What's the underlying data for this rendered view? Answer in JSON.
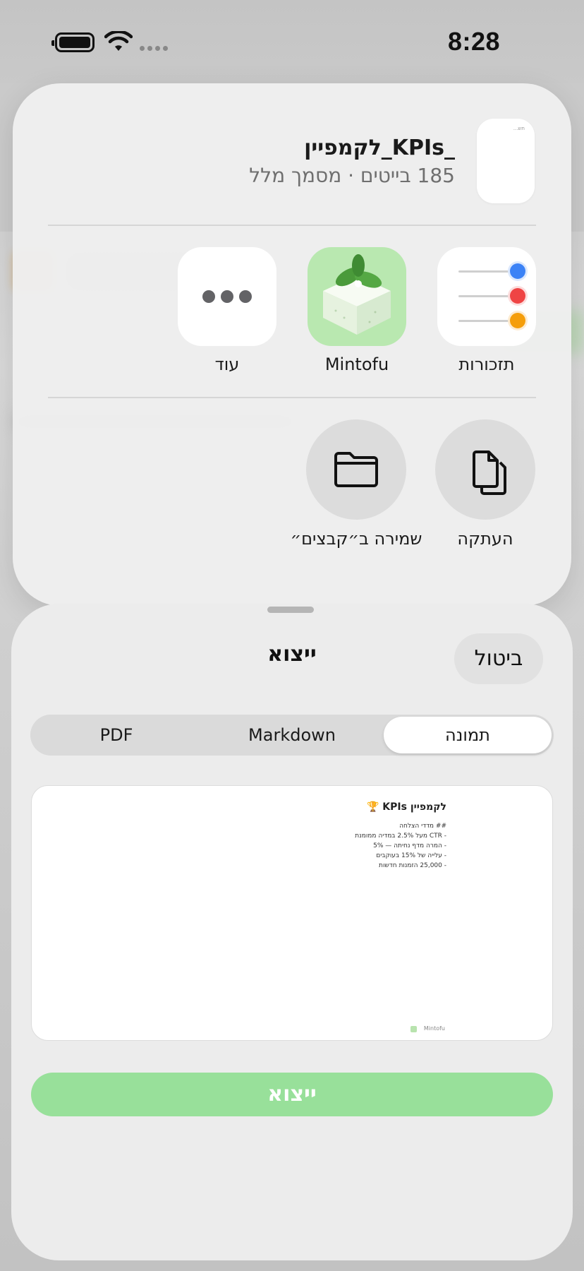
{
  "status_bar": {
    "time": "8:28",
    "battery_icon": "battery-full-icon",
    "wifi_icon": "wifi-icon",
    "signal_icon": "cellular-signal-dots-icon"
  },
  "share_sheet": {
    "file_name": "לקמפיין_KPIs_",
    "file_meta": "185 בייטים · מסמך מלל",
    "apps": [
      {
        "label": "תזכורות",
        "icon": "reminders-app-icon"
      },
      {
        "label": "Mintofu",
        "icon": "mintofu-app-icon"
      },
      {
        "label": "עוד",
        "icon": "more-ellipsis-icon"
      }
    ],
    "actions": [
      {
        "label": "העתקה",
        "icon": "copy-icon"
      },
      {
        "label": "שמירה ב״קבצים״",
        "icon": "folder-icon"
      }
    ],
    "thumbnail_text": "תש..."
  },
  "export_sheet": {
    "cancel_label": "ביטול",
    "title": "ייצוא",
    "formats": [
      "תמונה",
      "Markdown",
      "PDF"
    ],
    "selected_format": "תמונה",
    "preview": {
      "title": "לקמפיין KPIs 🏆",
      "lines": [
        "## מדדי הצלחה",
        "- CTR מעל 2.5% במדיה ממומנת",
        "- המרה מדף נחיתה — 5%",
        "- עלייה של 15% בעוקבים",
        "- 25,000 הזמנות חדשות"
      ],
      "brand": "Mintofu"
    },
    "export_button_label": "ייצוא"
  },
  "colors": {
    "accent_green": "#98e09a",
    "reminders_dots": [
      "#3b82f6",
      "#ef4444",
      "#f59e0b"
    ]
  }
}
